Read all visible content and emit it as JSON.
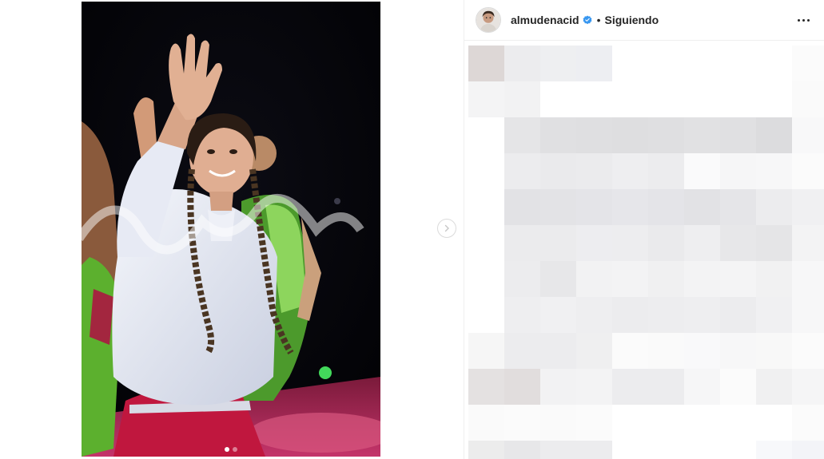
{
  "post": {
    "media_alt": "Photo",
    "carousel": {
      "total": 2,
      "active_index": 0
    }
  },
  "header": {
    "username": "almudenacid",
    "separator": "•",
    "follow_status": "Siguiendo"
  },
  "icons": {
    "verified": "verified-badge-icon",
    "more": "more-options-icon",
    "next": "chevron-right-icon"
  },
  "colors": {
    "verified_blue": "#3897f0",
    "divider": "#efefef",
    "shirt": "#e9ecf5",
    "skirt": "#c0173e",
    "stage_green": "#79d84a"
  }
}
